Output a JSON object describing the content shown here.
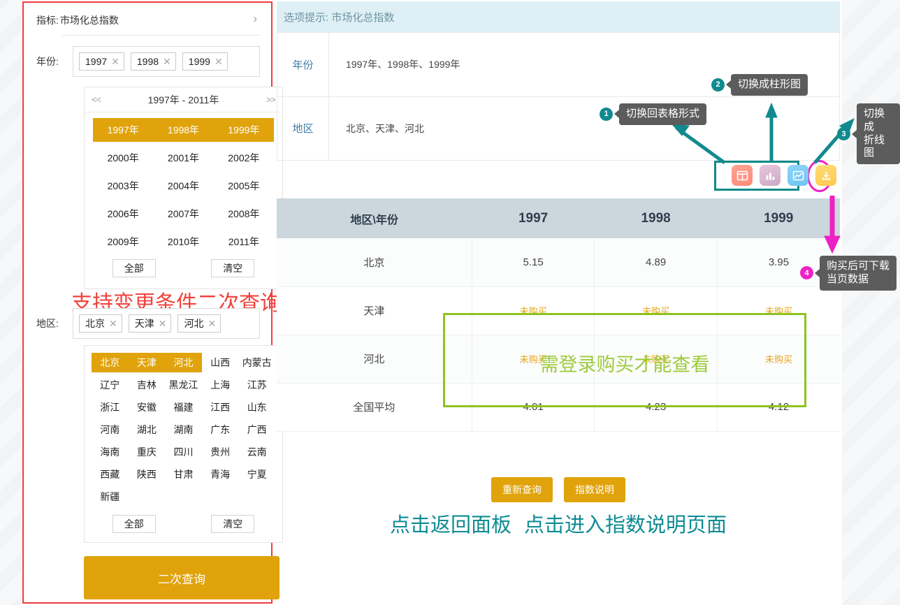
{
  "colors": {
    "gold": "#e0a30b",
    "teal": "#0e8b93",
    "magenta": "#ee22c4",
    "green": "#8ec31f",
    "red_annotation": "#f1423c",
    "header_blue": "#def0f5"
  },
  "left_panel": {
    "indicator": {
      "label": "指标:",
      "value": "市场化总指数",
      "chevron": "›"
    },
    "year_row": {
      "label": "年份:",
      "tags": [
        "1997",
        "1998",
        "1999"
      ],
      "tag_close": "✕"
    },
    "year_picker": {
      "prev": "<<",
      "range": "1997年 - 2011年",
      "next": ">>",
      "years": [
        {
          "label": "1997年",
          "selected": true
        },
        {
          "label": "1998年",
          "selected": true
        },
        {
          "label": "1999年",
          "selected": true
        },
        {
          "label": "2000年",
          "selected": false
        },
        {
          "label": "2001年",
          "selected": false
        },
        {
          "label": "2002年",
          "selected": false
        },
        {
          "label": "2003年",
          "selected": false
        },
        {
          "label": "2004年",
          "selected": false
        },
        {
          "label": "2005年",
          "selected": false
        },
        {
          "label": "2006年",
          "selected": false
        },
        {
          "label": "2007年",
          "selected": false
        },
        {
          "label": "2008年",
          "selected": false
        },
        {
          "label": "2009年",
          "selected": false
        },
        {
          "label": "2010年",
          "selected": false
        },
        {
          "label": "2011年",
          "selected": false
        }
      ],
      "select_all": "全部",
      "clear": "清空"
    },
    "region_row": {
      "label": "地区:",
      "tags": [
        "北京",
        "天津",
        "河北"
      ],
      "tag_close": "✕"
    },
    "region_picker": {
      "regions": [
        {
          "label": "北京",
          "selected": true
        },
        {
          "label": "天津",
          "selected": true
        },
        {
          "label": "河北",
          "selected": true
        },
        {
          "label": "山西",
          "selected": false
        },
        {
          "label": "内蒙古",
          "selected": false
        },
        {
          "label": "辽宁",
          "selected": false
        },
        {
          "label": "吉林",
          "selected": false
        },
        {
          "label": "黑龙江",
          "selected": false
        },
        {
          "label": "上海",
          "selected": false
        },
        {
          "label": "江苏",
          "selected": false
        },
        {
          "label": "浙江",
          "selected": false
        },
        {
          "label": "安徽",
          "selected": false
        },
        {
          "label": "福建",
          "selected": false
        },
        {
          "label": "江西",
          "selected": false
        },
        {
          "label": "山东",
          "selected": false
        },
        {
          "label": "河南",
          "selected": false
        },
        {
          "label": "湖北",
          "selected": false
        },
        {
          "label": "湖南",
          "selected": false
        },
        {
          "label": "广东",
          "selected": false
        },
        {
          "label": "广西",
          "selected": false
        },
        {
          "label": "海南",
          "selected": false
        },
        {
          "label": "重庆",
          "selected": false
        },
        {
          "label": "四川",
          "selected": false
        },
        {
          "label": "贵州",
          "selected": false
        },
        {
          "label": "云南",
          "selected": false
        },
        {
          "label": "西藏",
          "selected": false
        },
        {
          "label": "陕西",
          "selected": false
        },
        {
          "label": "甘肃",
          "selected": false
        },
        {
          "label": "青海",
          "selected": false
        },
        {
          "label": "宁夏",
          "selected": false
        },
        {
          "label": "新疆",
          "selected": false
        }
      ],
      "select_all": "全部",
      "clear": "清空"
    },
    "query_button": "二次查询",
    "annotation": "支持变更条件二次查询"
  },
  "right_panel": {
    "hint_bar": "选项提示: 市场化总指数",
    "conditions": [
      {
        "key": "年份",
        "value": "1997年、1998年、1999年"
      },
      {
        "key": "地区",
        "value": "北京、天津、河北"
      }
    ],
    "toolbar": [
      {
        "name": "table-view-icon",
        "title": "表格"
      },
      {
        "name": "bar-chart-icon",
        "title": "柱形图"
      },
      {
        "name": "line-chart-icon",
        "title": "折线图"
      },
      {
        "name": "download-icon",
        "title": "下载"
      }
    ],
    "bottom_buttons": [
      {
        "label": "重新查询"
      },
      {
        "label": "指数说明"
      }
    ],
    "bottom_annotations": [
      "点击返回面板",
      "点击进入指数说明页面"
    ],
    "locked_annotation": "需登录购买才能查看"
  },
  "chart_data": {
    "type": "table",
    "title": "市场化总指数",
    "columns": [
      "地区\\年份",
      "1997",
      "1998",
      "1999"
    ],
    "rows": [
      {
        "region": "北京",
        "values": [
          "5.15",
          "4.89",
          "3.95"
        ],
        "locked": false
      },
      {
        "region": "天津",
        "values": [
          "未购买",
          "未购买",
          "未购买"
        ],
        "locked": true
      },
      {
        "region": "河北",
        "values": [
          "未购买",
          "未购买",
          "未购买"
        ],
        "locked": true
      },
      {
        "region": "全国平均",
        "values": [
          "4.01",
          "4.23",
          "4.12"
        ],
        "locked": false
      }
    ],
    "xlabel": "年份",
    "ylabel": "市场化总指数"
  },
  "callouts": [
    {
      "num": "1",
      "text": "切换回表格形式",
      "color": "teal"
    },
    {
      "num": "2",
      "text": "切换成柱形图",
      "color": "teal"
    },
    {
      "num": "3",
      "text": "切换成\n折线图",
      "color": "teal"
    },
    {
      "num": "4",
      "text": "购买后可下载\n当页数据",
      "color": "magenta"
    }
  ]
}
